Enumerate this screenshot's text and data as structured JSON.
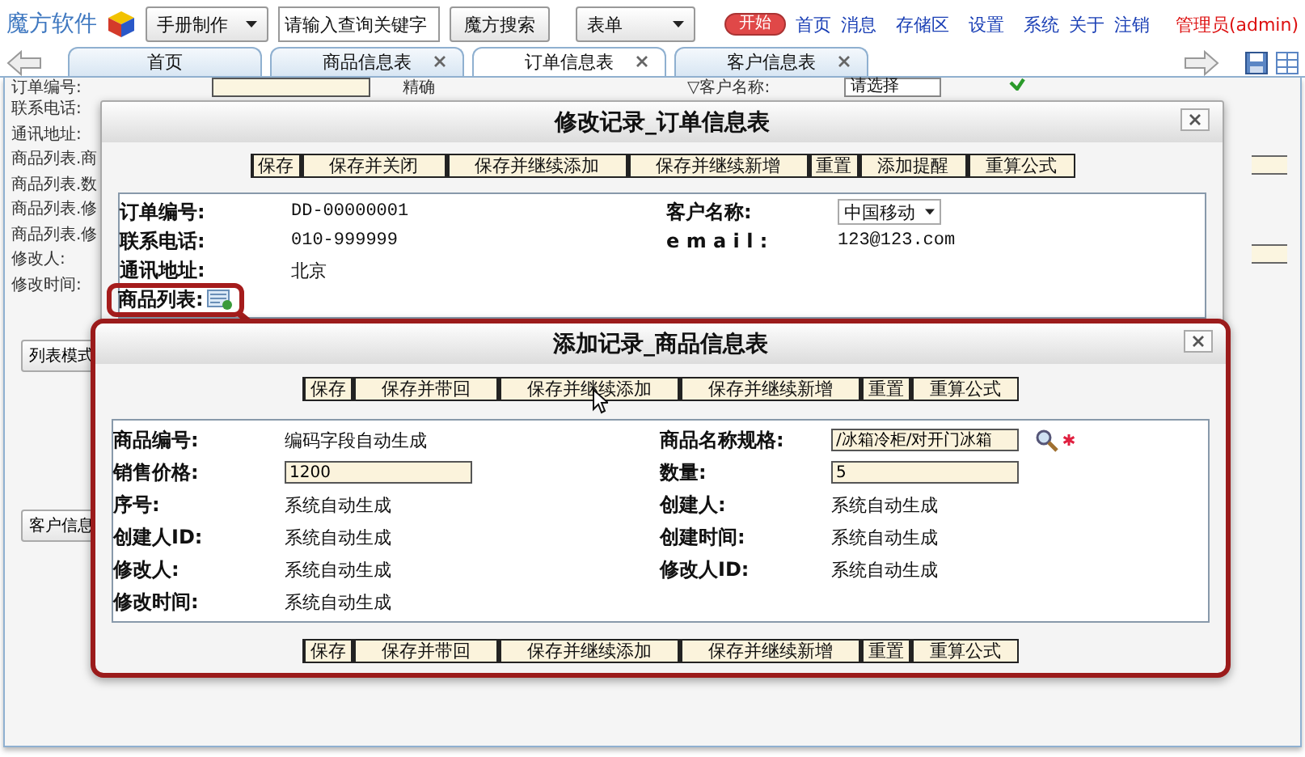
{
  "header": {
    "logo": "魔方软件",
    "manual_menu": "手册制作",
    "search": {
      "placeholder": "请输入查询关键字"
    },
    "search_button": "魔方搜索",
    "form_menu": "表单",
    "start_button": "开始",
    "links": [
      "首页",
      "消息",
      "存储区",
      "设置",
      "系统",
      "关于",
      "注销"
    ],
    "user": "管理员(admin)"
  },
  "tabs": [
    {
      "label": "首页",
      "closable": false,
      "selected": false
    },
    {
      "label": "商品信息表",
      "closable": true,
      "selected": false
    },
    {
      "label": "订单信息表",
      "closable": true,
      "selected": true
    },
    {
      "label": "客户信息表",
      "closable": true,
      "selected": false
    }
  ],
  "background": {
    "labels": [
      "订单编号:",
      "联系电话:",
      "通讯地址:",
      "商品列表.商",
      "商品列表.数",
      "商品列表.修",
      "商品列表.修",
      "修改人:",
      "修改时间:"
    ],
    "match_label": "精确",
    "customer_label": "▽客户名称:",
    "customer_select": "请选择",
    "buttons": [
      "列表模式",
      "客户信息"
    ]
  },
  "order_dialog": {
    "title": "修改记录_订单信息表",
    "buttons": [
      "保存",
      "保存并关闭",
      "保存并继续添加",
      "保存并继续新增",
      "重置",
      "添加提醒",
      "重算公式"
    ],
    "rows": [
      [
        {
          "label": "订单编号:",
          "kind": "text",
          "value": "DD-00000001",
          "highlighted": false
        },
        {
          "label": "客户名称:",
          "kind": "select",
          "value": "中国移动",
          "highlighted": false
        }
      ],
      [
        {
          "label": "联系电话:",
          "kind": "text",
          "value": "010-999999",
          "highlighted": false
        },
        {
          "label": "e m a i l :",
          "kind": "text",
          "value": "123@123.com",
          "highlighted": false
        }
      ],
      [
        {
          "label": "通讯地址:",
          "kind": "text",
          "value": "北京",
          "highlighted": false
        }
      ],
      [
        {
          "label": "商品列表:",
          "kind": "attach",
          "highlighted": true
        }
      ]
    ]
  },
  "product_dialog": {
    "title": "添加记录_商品信息表",
    "buttons": [
      "保存",
      "保存并带回",
      "保存并继续添加",
      "保存并继续新增",
      "重置",
      "重算公式"
    ],
    "rows": [
      [
        {
          "label": "商品编号:",
          "kind": "text",
          "value": "编码字段自动生成"
        },
        {
          "label": "商品名称规格:",
          "kind": "lookup",
          "value": "/冰箱冷柜/对开门冰箱"
        }
      ],
      [
        {
          "label": "销售价格:",
          "kind": "input",
          "value": "1200"
        },
        {
          "label": "数量:",
          "kind": "input",
          "value": "5"
        }
      ],
      [
        {
          "label": "序号:",
          "kind": "text",
          "value": "系统自动生成"
        },
        {
          "label": "创建人:",
          "kind": "text",
          "value": "系统自动生成"
        }
      ],
      [
        {
          "label": "创建人ID:",
          "kind": "text",
          "value": "系统自动生成"
        },
        {
          "label": "创建时间:",
          "kind": "text",
          "value": "系统自动生成"
        }
      ],
      [
        {
          "label": "修改人:",
          "kind": "text",
          "value": "系统自动生成"
        },
        {
          "label": "修改人ID:",
          "kind": "text",
          "value": "系统自动生成"
        }
      ],
      [
        {
          "label": "修改时间:",
          "kind": "text",
          "value": "系统自动生成"
        }
      ]
    ],
    "bottom_buttons": [
      "保存",
      "保存并带回",
      "保存并继续添加",
      "保存并继续新增",
      "重置",
      "重算公式"
    ]
  }
}
